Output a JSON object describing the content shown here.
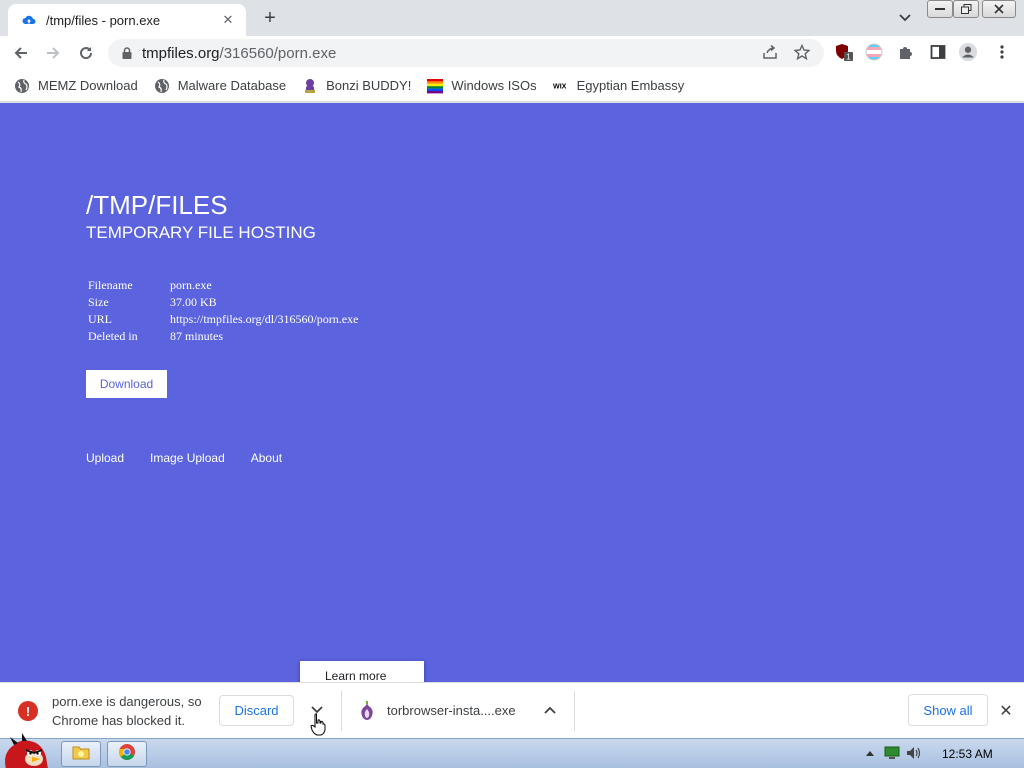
{
  "browser": {
    "tab_title": "/tmp/files - porn.exe",
    "url_host": "tmpfiles.org",
    "url_path": "/316560/porn.exe",
    "extension_badge": "1"
  },
  "bookmarks": [
    {
      "label": "MEMZ Download",
      "icon": "globe-icon"
    },
    {
      "label": "Malware Database",
      "icon": "globe-icon"
    },
    {
      "label": "Bonzi BUDDY!",
      "icon": "bonzi-icon"
    },
    {
      "label": "Windows ISOs",
      "icon": "rainbow-flag-icon"
    },
    {
      "label": "Egyptian Embassy",
      "icon": "wix-icon"
    }
  ],
  "page": {
    "title": "/TMP/FILES",
    "subtitle": "TEMPORARY FILE HOSTING",
    "info": [
      {
        "key": "Filename",
        "value": "porn.exe"
      },
      {
        "key": "Size",
        "value": "37.00 KB"
      },
      {
        "key": "URL",
        "value": "https://tmpfiles.org/dl/316560/porn.exe"
      },
      {
        "key": "Deleted in",
        "value": "87 minutes"
      }
    ],
    "download_label": "Download",
    "footer_links": [
      "Upload",
      "Image Upload",
      "About"
    ],
    "background_color": "#5b63de"
  },
  "popup": {
    "learn_more": "Learn more"
  },
  "download_shelf": {
    "blocked_item": {
      "message": "porn.exe is dangerous, so Chrome has blocked it.",
      "discard_label": "Discard"
    },
    "second_item": {
      "filename": "torbrowser-insta....exe"
    },
    "show_all_label": "Show all"
  },
  "taskbar": {
    "clock": "12:53 AM"
  }
}
